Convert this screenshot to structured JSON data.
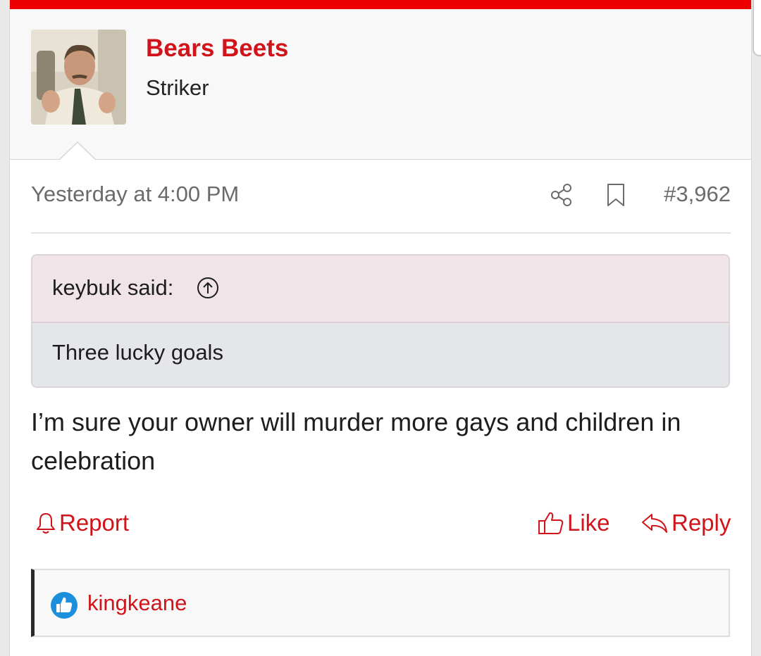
{
  "post": {
    "author": {
      "name": "Bears Beets",
      "title": "Striker"
    },
    "timestamp": "Yesterday at 4:00 PM",
    "number": "#3,962",
    "quote": {
      "author_label": "keybuk said:",
      "text": "Three lucky goals"
    },
    "message": "I’m sure your owner will murder more gays and children in celebration",
    "actions": {
      "report": "Report",
      "like": "Like",
      "reply": "Reply"
    },
    "reactions": {
      "user": "kingkeane",
      "icon": "thumbs-up-icon"
    }
  },
  "colors": {
    "accent": "#d0141a",
    "top_bar": "#ee0000",
    "like_badge": "#1b8fdb"
  }
}
